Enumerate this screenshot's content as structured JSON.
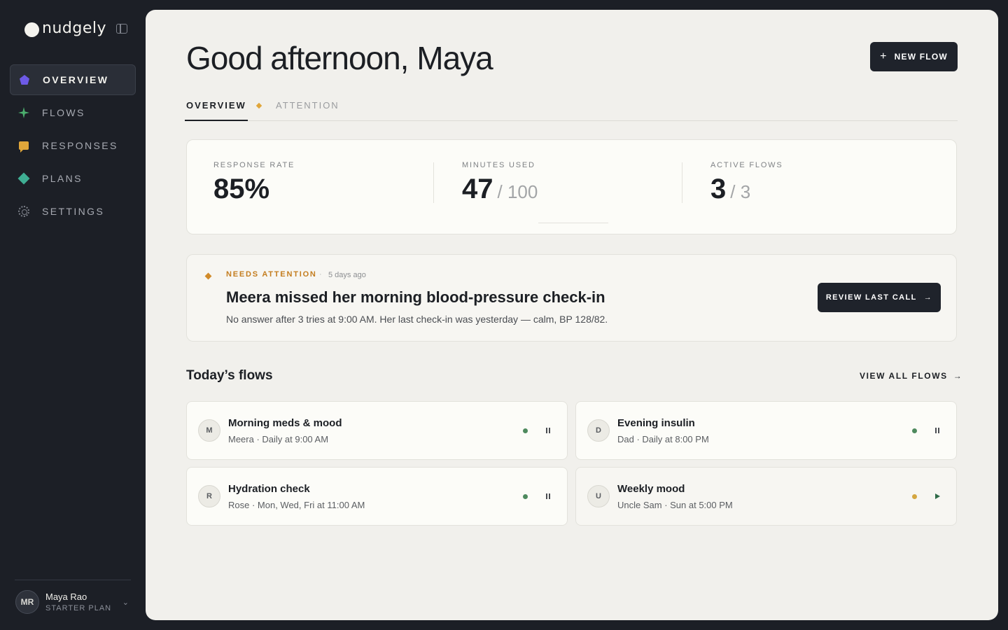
{
  "app": {
    "name": "nudgely"
  },
  "colors": {
    "status_active": "#4e8a5e",
    "status_paused": "#d4a640",
    "accent_attention": "#d18b2a"
  },
  "sidebar": {
    "items": [
      {
        "label": "OVERVIEW",
        "icon": "pentagon-icon",
        "active": true
      },
      {
        "label": "FLOWS",
        "icon": "sparkle-icon",
        "active": false
      },
      {
        "label": "RESPONSES",
        "icon": "chat-icon",
        "active": false
      },
      {
        "label": "PLANS",
        "icon": "diamond-icon",
        "active": false
      },
      {
        "label": "SETTINGS",
        "icon": "gear-icon",
        "active": false
      }
    ],
    "user": {
      "initials": "MR",
      "name": "Maya Rao",
      "plan": "STARTER PLAN"
    }
  },
  "header": {
    "greeting": "Good afternoon, Maya",
    "new_flow_label": "NEW FLOW"
  },
  "tabs": [
    {
      "label": "OVERVIEW",
      "active": true
    },
    {
      "label": "ATTENTION",
      "active": false
    }
  ],
  "stats": {
    "response_rate": {
      "label": "RESPONSE RATE",
      "value": "85%"
    },
    "minutes_used": {
      "label": "MINUTES USED",
      "value": "47",
      "total": "/ 100"
    },
    "active_flows": {
      "label": "ACTIVE FLOWS",
      "value": "3",
      "total": "/ 3"
    }
  },
  "alert": {
    "tag": "NEEDS ATTENTION",
    "separator": "·",
    "time": "5 days ago",
    "title": "Meera missed her morning blood-pressure check-in",
    "description": "No answer after 3 tries at 9:00 AM. Her last check-in was yesterday — calm, BP 128/82.",
    "button_label": "REVIEW LAST CALL"
  },
  "flows": {
    "title": "Today’s flows",
    "view_all_label": "VIEW ALL FLOWS",
    "items": [
      {
        "initial": "M",
        "name": "Morning meds & mood",
        "meta": "Meera · Daily at 9:00 AM",
        "status": "active"
      },
      {
        "initial": "D",
        "name": "Evening insulin",
        "meta": "Dad · Daily at 8:00 PM",
        "status": "active"
      },
      {
        "initial": "R",
        "name": "Hydration check",
        "meta": "Rose · Mon, Wed, Fri at 11:00 AM",
        "status": "active"
      },
      {
        "initial": "U",
        "name": "Weekly mood",
        "meta": "Uncle Sam · Sun at 5:00 PM",
        "status": "paused"
      }
    ]
  }
}
